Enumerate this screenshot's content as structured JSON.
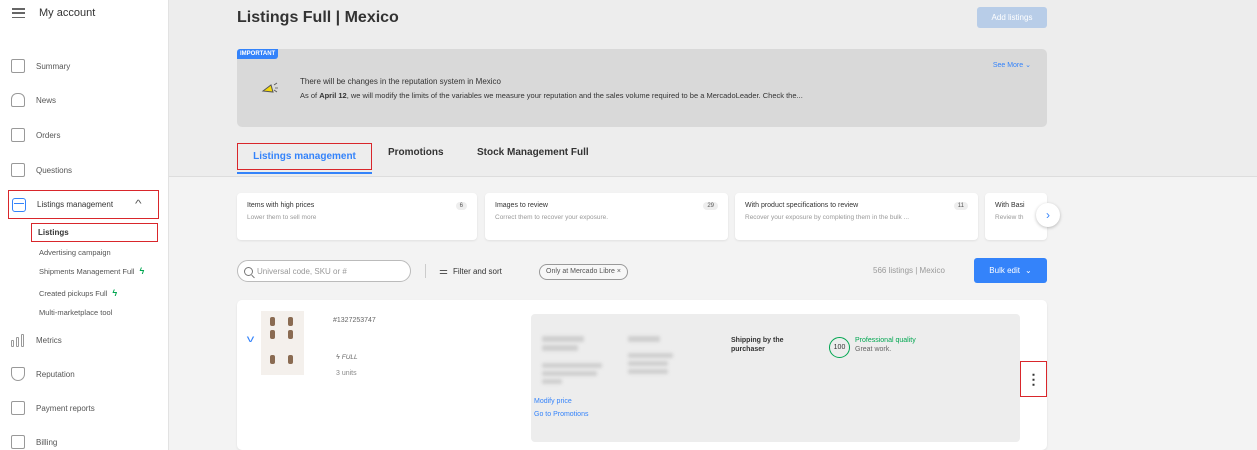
{
  "sidebar": {
    "title": "My account",
    "items": [
      {
        "label": "Summary"
      },
      {
        "label": "News"
      },
      {
        "label": "Orders"
      },
      {
        "label": "Questions"
      },
      {
        "label": "Listings management"
      },
      {
        "label": "Metrics"
      },
      {
        "label": "Reputation"
      },
      {
        "label": "Payment reports"
      },
      {
        "label": "Billing"
      }
    ],
    "subitems": [
      {
        "label": "Listings"
      },
      {
        "label": "Advertising campaign"
      },
      {
        "label": "Shipments Management Full"
      },
      {
        "label": "Created pickups Full"
      },
      {
        "label": "Multi-marketplace tool"
      }
    ]
  },
  "header": {
    "title": "Listings Full | Mexico",
    "add_button": "Add listings"
  },
  "banner": {
    "badge": "IMPORTANT",
    "see_more": "See More",
    "title": "There will be changes in the reputation system in Mexico",
    "text_prefix": "As of ",
    "text_bold": "April 12",
    "text_suffix": ", we will modify the limits of the variables we measure your reputation and the sales volume required to be a MercadoLeader. Check the..."
  },
  "tabs": [
    {
      "label": "Listings management",
      "active": true
    },
    {
      "label": "Promotions"
    },
    {
      "label": "Stock Management Full"
    }
  ],
  "cards": [
    {
      "title": "Items with high prices",
      "subtitle": "Lower them to sell more",
      "count": "6"
    },
    {
      "title": "Images to review",
      "subtitle": "Correct them to recover your exposure.",
      "count": "29"
    },
    {
      "title": "With product specifications to review",
      "subtitle": "Recover your exposure by completing them in the bulk ...",
      "count": "11"
    },
    {
      "title": "With Basi",
      "subtitle": "Review th"
    }
  ],
  "toolbar": {
    "search_placeholder": "Universal code, SKU or #",
    "filter_label": "Filter and sort",
    "chip_label": "Only at Mercado Libre",
    "chip_close": "×",
    "count_text": "566 listings | Mexico",
    "bulk_edit": "Bulk edit"
  },
  "listing": {
    "id": "#1327253747",
    "fulfillment": "FULL",
    "units": "3 units",
    "modify_price": "Modify price",
    "go_promotions": "Go to Promotions",
    "shipping": "Shipping by the purchaser",
    "score": "100",
    "quality": "Professional quality",
    "quality_note": "Great work."
  },
  "colors": {
    "accent": "#3483fa",
    "highlight": "#d9262b",
    "success": "#00a650"
  }
}
